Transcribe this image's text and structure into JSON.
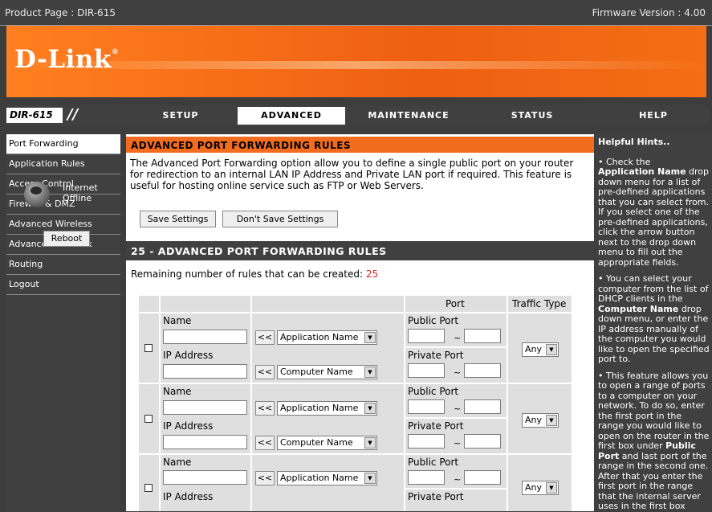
{
  "header": {
    "product": "Product Page : DIR-615",
    "firmware": "Firmware Version : 4.00"
  },
  "brand": {
    "logo": "D-Link",
    "model": "DIR-615"
  },
  "tabs": [
    "SETUP",
    "ADVANCED",
    "MAINTENANCE",
    "STATUS",
    "HELP"
  ],
  "sidebar": {
    "items": [
      "Port Forwarding",
      "Application Rules",
      "Access Control",
      "Firewall & DMZ",
      "Advanced Wireless",
      "Advanced Network",
      "Routing",
      "Logout"
    ],
    "internet_status": "Internet",
    "internet_state": "Offline",
    "reboot": "Reboot"
  },
  "main": {
    "title": "ADVANCED PORT FORWARDING RULES",
    "intro": "The Advanced Port Forwarding option allow you to define a single public port on your router for redirection to an internal LAN IP Address and Private LAN port if required. This feature is useful for hosting online service such as FTP or Web Servers.",
    "save": "Save Settings",
    "dont_save": "Don't Save Settings",
    "rules_title": "25 - ADVANCED PORT FORWARDING RULES",
    "remaining_label": "Remaining number of rules that can be created:",
    "remaining_value": "25",
    "col_port": "Port",
    "col_traffic": "Traffic Type",
    "lbl_name": "Name",
    "lbl_ip": "IP Address",
    "lbl_public": "Public Port",
    "lbl_private": "Private Port",
    "arrow": "<<",
    "tilde": "~",
    "app_select": "Application Name",
    "comp_select": "Computer Name",
    "traffic_value": "Any"
  },
  "help": {
    "title": "Helpful Hints..",
    "tip1_a": "• Check the ",
    "tip1_b": "Application Name",
    "tip1_c": " drop down menu for a list of pre-defined applications that you can select from. If you select one of the pre-defined applications, click the arrow button next to the drop down menu to fill out the appropriate fields.",
    "tip2_a": "• You can select your computer from the list of DHCP clients in the ",
    "tip2_b": "Computer Name",
    "tip2_c": " drop down menu, or enter the IP address manually of the computer you would like to open the specified port to.",
    "tip3_a": "• This feature allows you to open a range of ports to a computer on your network. To do so, enter the first port in the range you would like to open on the router in the first box under ",
    "tip3_b": "Public Port",
    "tip3_c": " and last port of the range in the second one. After that you enter the first port in the range that the internal server uses in the first box"
  }
}
